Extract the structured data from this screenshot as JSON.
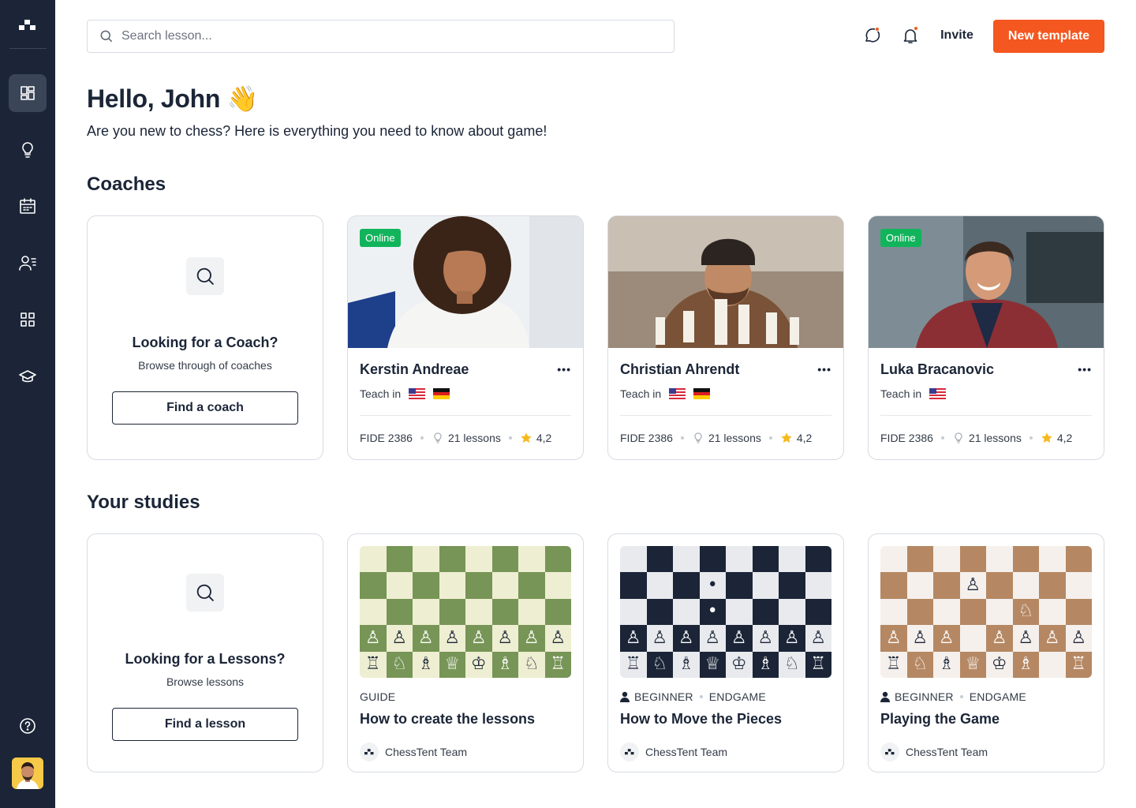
{
  "search": {
    "placeholder": "Search lesson..."
  },
  "topbar": {
    "invite_label": "Invite",
    "new_template_label": "New template"
  },
  "greeting": {
    "title": "Hello, John 👋",
    "subtitle": "Are you new to chess? Here is everything you need to know about game!"
  },
  "coaches": {
    "section_title": "Coaches",
    "finder": {
      "title": "Looking for a Coach?",
      "subtitle": "Browse through of coaches",
      "button": "Find a coach"
    },
    "teach_label": "Teach in",
    "items": [
      {
        "name": "Kerstin Andreae",
        "status": "Online",
        "fide": "FIDE 2386",
        "lessons": "21 lessons",
        "rating": "4,2",
        "flags": [
          "us",
          "de"
        ]
      },
      {
        "name": "Christian Ahrendt",
        "status": "",
        "fide": "FIDE 2386",
        "lessons": "21 lessons",
        "rating": "4,2",
        "flags": [
          "us",
          "de"
        ]
      },
      {
        "name": "Luka Bracanovic",
        "status": "Online",
        "fide": "FIDE 2386",
        "lessons": "21 lessons",
        "rating": "4,2",
        "flags": [
          "us"
        ]
      }
    ]
  },
  "studies": {
    "section_title": "Your studies",
    "finder": {
      "title": "Looking for a Lessons?",
      "subtitle": "Browse lessons",
      "button": "Find a lesson"
    },
    "items": [
      {
        "category": "GUIDE",
        "level": "",
        "title": "How to create the lessons",
        "author": "ChessTent Team"
      },
      {
        "category": "ENDGAME",
        "level": "BEGINNER",
        "title": "How to Move the Pieces",
        "author": "ChessTent Team"
      },
      {
        "category": "ENDGAME",
        "level": "BEGINNER",
        "title": "Playing the Game",
        "author": "ChessTent Team"
      }
    ]
  },
  "colors": {
    "accent": "#f4571f",
    "sidebar": "#1b2537",
    "online": "#12b45b",
    "star": "#f6b91b"
  },
  "icons": [
    "logo-icon",
    "dashboard-icon",
    "lightbulb-icon",
    "calendar-icon",
    "users-icon",
    "grid-icon",
    "graduation-cap-icon",
    "help-icon",
    "search-icon",
    "chat-icon",
    "bell-icon",
    "star-icon"
  ]
}
